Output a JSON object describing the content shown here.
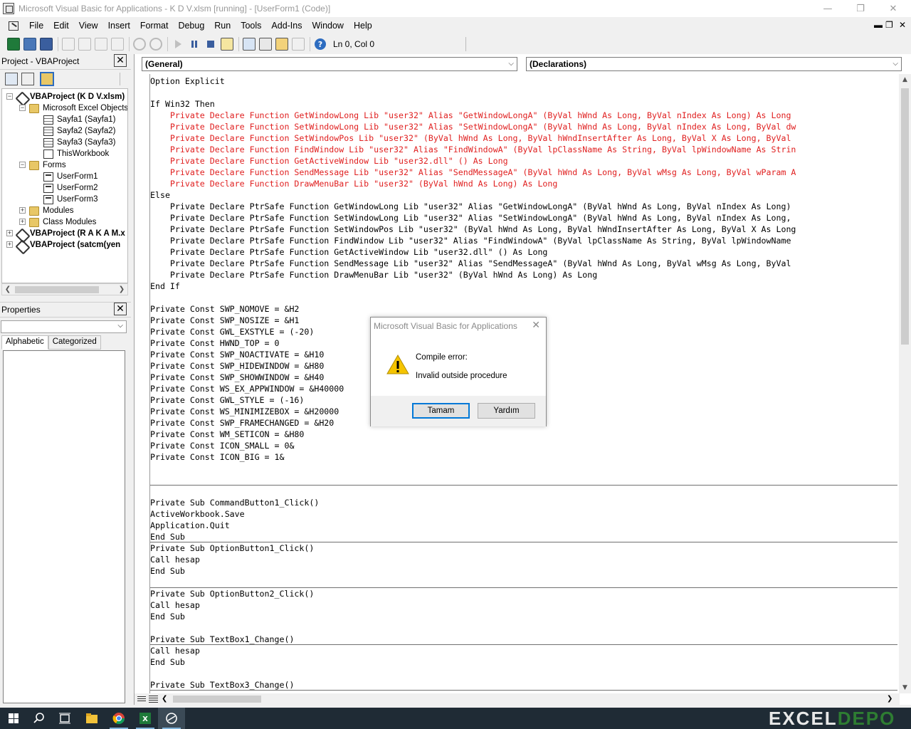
{
  "window": {
    "title": "Microsoft Visual Basic for Applications - K D V.xlsm [running] - [UserForm1 (Code)]"
  },
  "menu": [
    "File",
    "Edit",
    "View",
    "Insert",
    "Format",
    "Debug",
    "Run",
    "Tools",
    "Add-Ins",
    "Window",
    "Help"
  ],
  "toolbar": {
    "position": "Ln 0, Col 0"
  },
  "project_panel": {
    "title": "Project - VBAProject",
    "tree": [
      {
        "label": "VBAProject (K D V.xlsm)",
        "level": 0,
        "icon": "project-icon",
        "bold": true,
        "expander": "−"
      },
      {
        "label": "Microsoft Excel Objects",
        "level": 1,
        "icon": "folder-icon",
        "bold": false,
        "expander": "−"
      },
      {
        "label": "Sayfa1 (Sayfa1)",
        "level": 2,
        "icon": "sheet-icon",
        "bold": false,
        "expander": ""
      },
      {
        "label": "Sayfa2 (Sayfa2)",
        "level": 2,
        "icon": "sheet-icon",
        "bold": false,
        "expander": ""
      },
      {
        "label": "Sayfa3 (Sayfa3)",
        "level": 2,
        "icon": "sheet-icon",
        "bold": false,
        "expander": ""
      },
      {
        "label": "ThisWorkbook",
        "level": 2,
        "icon": "workbook-icon",
        "bold": false,
        "expander": ""
      },
      {
        "label": "Forms",
        "level": 1,
        "icon": "folder-icon",
        "bold": false,
        "expander": "−"
      },
      {
        "label": "UserForm1",
        "level": 2,
        "icon": "form-icon",
        "bold": false,
        "expander": ""
      },
      {
        "label": "UserForm2",
        "level": 2,
        "icon": "form-icon",
        "bold": false,
        "expander": ""
      },
      {
        "label": "UserForm3",
        "level": 2,
        "icon": "form-icon",
        "bold": false,
        "expander": ""
      },
      {
        "label": "Modules",
        "level": 1,
        "icon": "folder-icon",
        "bold": false,
        "expander": "+"
      },
      {
        "label": "Class Modules",
        "level": 1,
        "icon": "folder-icon",
        "bold": false,
        "expander": "+"
      },
      {
        "label": "VBAProject (R A K A M.x",
        "level": 0,
        "icon": "project-icon",
        "bold": true,
        "expander": "+"
      },
      {
        "label": "VBAProject (satcm(yen",
        "level": 0,
        "icon": "project-icon",
        "bold": true,
        "expander": "+"
      }
    ]
  },
  "properties_panel": {
    "title": "Properties",
    "tabs": [
      "Alphabetic",
      "Categorized"
    ]
  },
  "code_window": {
    "object_combo": "(General)",
    "procedure_combo": "(Declarations)",
    "lines": [
      {
        "t": "Option Explicit",
        "err": false
      },
      {
        "t": "",
        "err": false
      },
      {
        "t": "If Win32 Then",
        "err": false
      },
      {
        "t": "    Private Declare Function GetWindowLong Lib \"user32\" Alias \"GetWindowLongA\" (ByVal hWnd As Long, ByVal nIndex As Long) As Long",
        "err": true
      },
      {
        "t": "    Private Declare Function SetWindowLong Lib \"user32\" Alias \"SetWindowLongA\" (ByVal hWnd As Long, ByVal nIndex As Long, ByVal dw",
        "err": true
      },
      {
        "t": "    Private Declare Function SetWindowPos Lib \"user32\" (ByVal hWnd As Long, ByVal hWndInsertAfter As Long, ByVal X As Long, ByVal",
        "err": true
      },
      {
        "t": "    Private Declare Function FindWindow Lib \"user32\" Alias \"FindWindowA\" (ByVal lpClassName As String, ByVal lpWindowName As Strin",
        "err": true
      },
      {
        "t": "    Private Declare Function GetActiveWindow Lib \"user32.dll\" () As Long",
        "err": true
      },
      {
        "t": "    Private Declare Function SendMessage Lib \"user32\" Alias \"SendMessageA\" (ByVal hWnd As Long, ByVal wMsg As Long, ByVal wParam A",
        "err": true
      },
      {
        "t": "    Private Declare Function DrawMenuBar Lib \"user32\" (ByVal hWnd As Long) As Long",
        "err": true
      },
      {
        "t": "Else",
        "err": false
      },
      {
        "t": "    Private Declare PtrSafe Function GetWindowLong Lib \"user32\" Alias \"GetWindowLongA\" (ByVal hWnd As Long, ByVal nIndex As Long)",
        "err": false
      },
      {
        "t": "    Private Declare PtrSafe Function SetWindowLong Lib \"user32\" Alias \"SetWindowLongA\" (ByVal hWnd As Long, ByVal nIndex As Long,",
        "err": false
      },
      {
        "t": "    Private Declare PtrSafe Function SetWindowPos Lib \"user32\" (ByVal hWnd As Long, ByVal hWndInsertAfter As Long, ByVal X As Long",
        "err": false
      },
      {
        "t": "    Private Declare PtrSafe Function FindWindow Lib \"user32\" Alias \"FindWindowA\" (ByVal lpClassName As String, ByVal lpWindowName",
        "err": false
      },
      {
        "t": "    Private Declare PtrSafe Function GetActiveWindow Lib \"user32.dll\" () As Long",
        "err": false
      },
      {
        "t": "    Private Declare PtrSafe Function SendMessage Lib \"user32\" Alias \"SendMessageA\" (ByVal hWnd As Long, ByVal wMsg As Long, ByVal",
        "err": false
      },
      {
        "t": "    Private Declare PtrSafe Function DrawMenuBar Lib \"user32\" (ByVal hWnd As Long) As Long",
        "err": false
      },
      {
        "t": "End If",
        "err": false
      },
      {
        "t": "",
        "err": false
      },
      {
        "t": "Private Const SWP_NOMOVE = &H2",
        "err": false
      },
      {
        "t": "Private Const SWP_NOSIZE = &H1",
        "err": false
      },
      {
        "t": "Private Const GWL_EXSTYLE = (-20)",
        "err": false
      },
      {
        "t": "Private Const HWND_TOP = 0",
        "err": false
      },
      {
        "t": "Private Const SWP_NOACTIVATE = &H10",
        "err": false
      },
      {
        "t": "Private Const SWP_HIDEWINDOW = &H80",
        "err": false
      },
      {
        "t": "Private Const SWP_SHOWWINDOW = &H40",
        "err": false
      },
      {
        "t": "Private Const WS_EX_APPWINDOW = &H40000",
        "err": false
      },
      {
        "t": "Private Const GWL_STYLE = (-16)",
        "err": false
      },
      {
        "t": "Private Const WS_MINIMIZEBOX = &H20000",
        "err": false
      },
      {
        "t": "Private Const SWP_FRAMECHANGED = &H20",
        "err": false
      },
      {
        "t": "Private Const WM_SETICON = &H80",
        "err": false
      },
      {
        "t": "Private Const ICON_SMALL = 0&",
        "err": false
      },
      {
        "t": "Private Const ICON_BIG = 1&",
        "err": false
      },
      {
        "t": "",
        "err": false
      },
      {
        "t": "",
        "err": false
      },
      {
        "t": "",
        "err": false
      },
      {
        "t": "Private Sub CommandButton1_Click()",
        "err": false
      },
      {
        "t": "ActiveWorkbook.Save",
        "err": false
      },
      {
        "t": "Application.Quit",
        "err": false
      },
      {
        "t": "End Sub",
        "err": false
      },
      {
        "t": "Private Sub OptionButton1_Click()",
        "err": false
      },
      {
        "t": "Call hesap",
        "err": false
      },
      {
        "t": "End Sub",
        "err": false
      },
      {
        "t": "",
        "err": false
      },
      {
        "t": "Private Sub OptionButton2_Click()",
        "err": false
      },
      {
        "t": "Call hesap",
        "err": false
      },
      {
        "t": "End Sub",
        "err": false
      },
      {
        "t": "",
        "err": false
      },
      {
        "t": "Private Sub TextBox1_Change()",
        "err": false
      },
      {
        "t": "Call hesap",
        "err": false
      },
      {
        "t": "End Sub",
        "err": false
      },
      {
        "t": "",
        "err": false
      },
      {
        "t": "Private Sub TextBox3_Change()",
        "err": false
      }
    ]
  },
  "dialog": {
    "title": "Microsoft Visual Basic for Applications",
    "message_1": "Compile error:",
    "message_2": "Invalid outside procedure",
    "ok_label": "Tamam",
    "help_label": "Yardım"
  },
  "taskbar": {
    "items": [
      "start-icon",
      "search-icon",
      "task-view-icon",
      "file-explorer-icon",
      "chrome-icon",
      "excel-icon",
      "vba-editor-icon"
    ]
  },
  "watermark": {
    "text_1": "EXCEL",
    "text_2": "DEPO"
  },
  "colors": {
    "error_text": "#e02020",
    "taskbar": "#1f2b35",
    "dialog_default_border": "#0078d7"
  }
}
